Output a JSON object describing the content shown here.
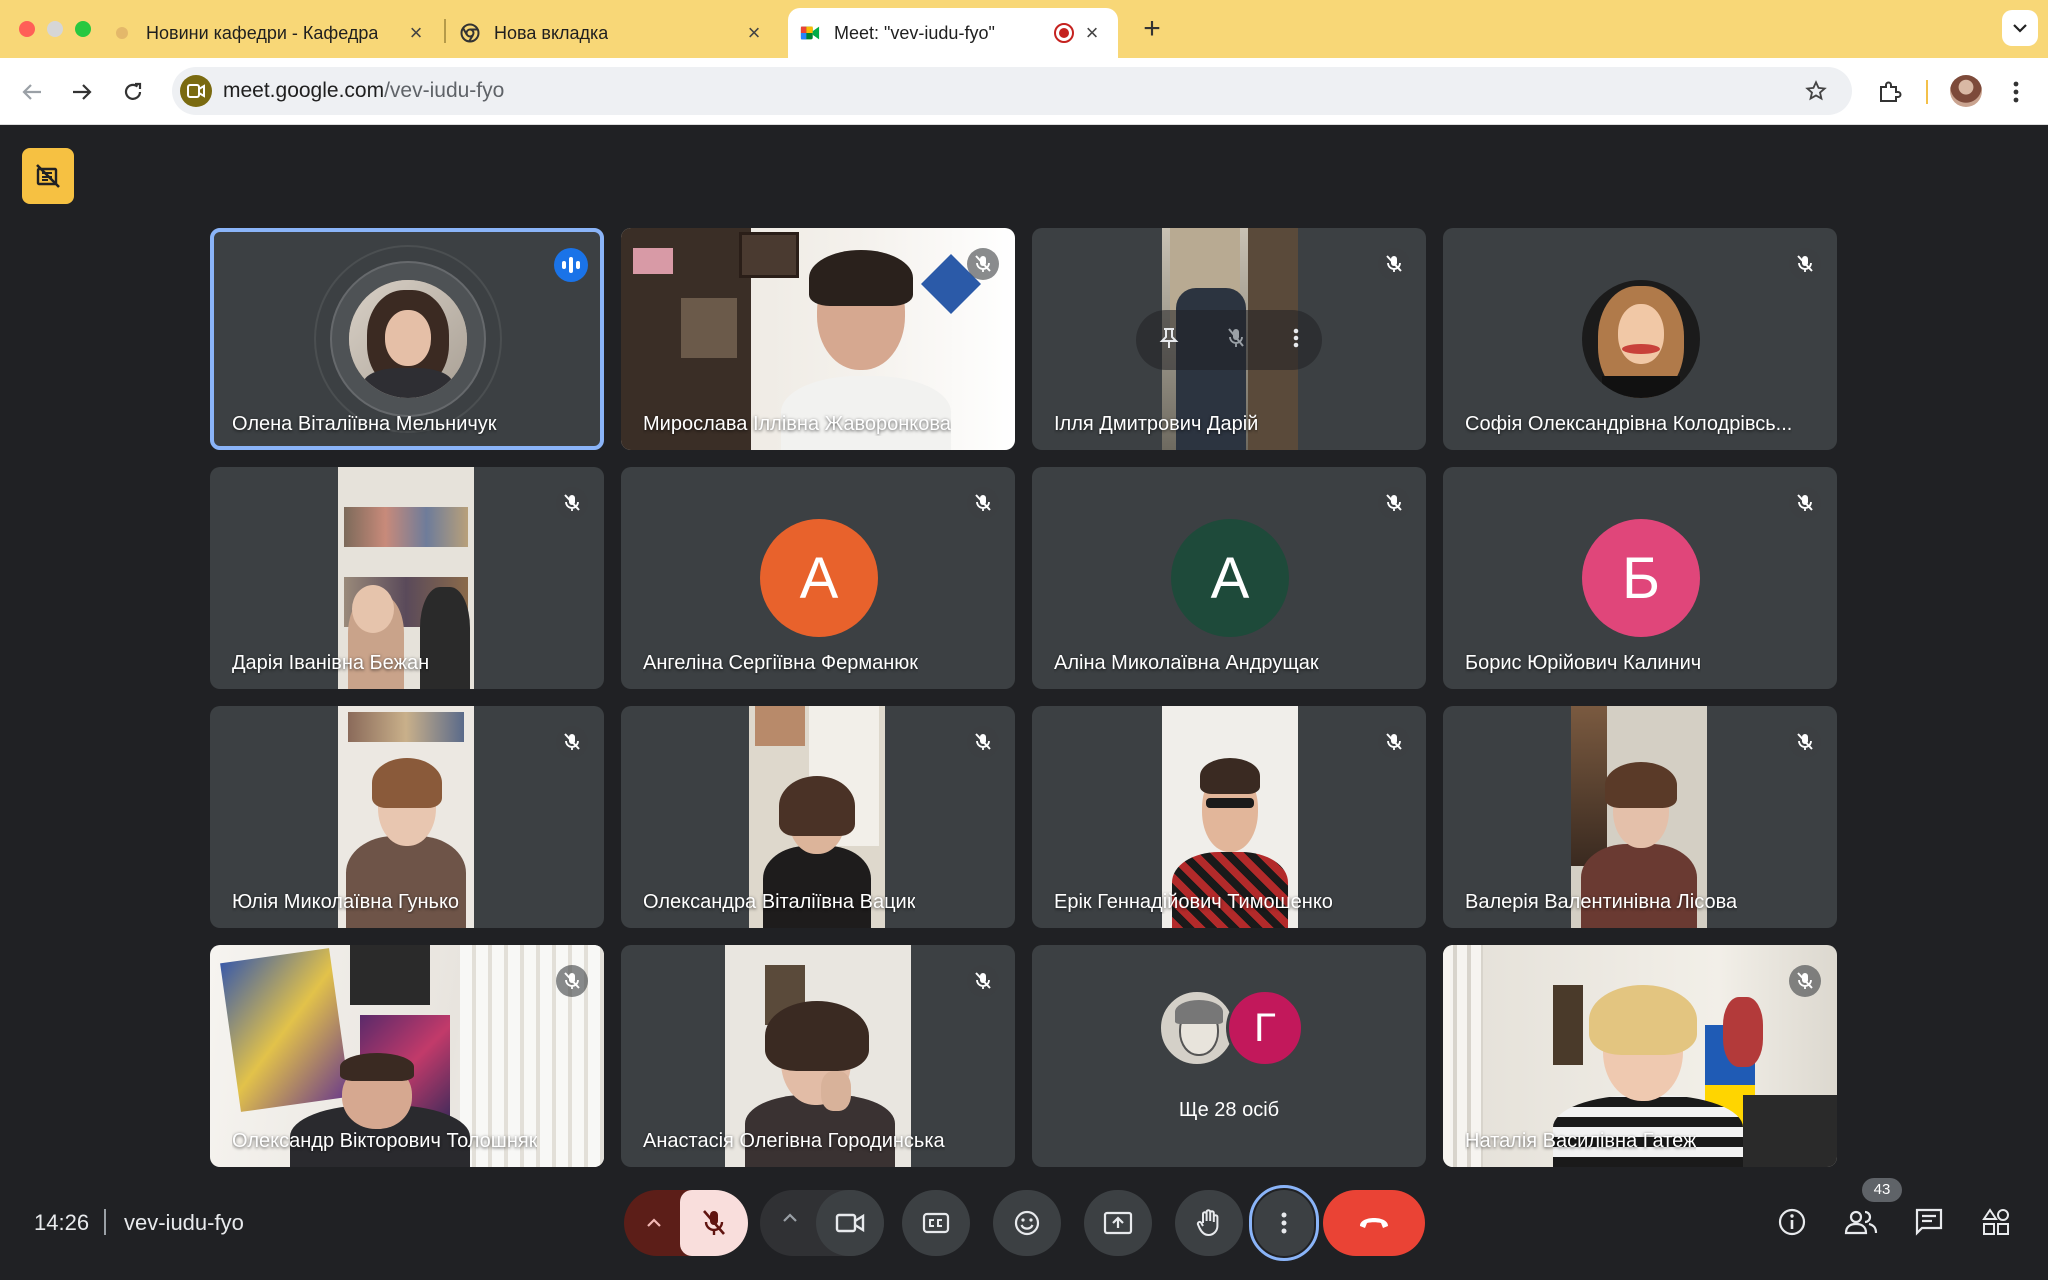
{
  "browser": {
    "tabs": [
      {
        "title": "Новини кафедри - Кафедра",
        "active": false
      },
      {
        "title": "Нова вкладка",
        "active": false
      },
      {
        "title": "Meet: \"vev-iudu-fyo\"",
        "active": true
      }
    ],
    "url_host": "meet.google.com",
    "url_path": "/vev-iudu-fyo",
    "new_tab_label": "+"
  },
  "meet": {
    "participants": [
      {
        "name": "Олена Віталіївна Мельничук",
        "speaking": true
      },
      {
        "name": "Мирослава Іллівна Жаворонкова"
      },
      {
        "name": "Ілля Дмитрович Дарій"
      },
      {
        "name": "Софія Олександрівна Колодрівсь..."
      },
      {
        "name": "Дарія Іванівна Бежан"
      },
      {
        "name": "Ангеліна Сергіївна Ферманюк",
        "initial": "А",
        "color": "#e8622c"
      },
      {
        "name": "Аліна Миколаївна Андрущак",
        "initial": "А",
        "color": "#1e4a3a"
      },
      {
        "name": "Борис Юрійович Калинич",
        "initial": "Б",
        "color": "#e0467a"
      },
      {
        "name": "Юлія Миколаївна Гунько"
      },
      {
        "name": "Олександра Віталіївна Вацик"
      },
      {
        "name": "Ерік Геннадійович Тимошенко"
      },
      {
        "name": "Валерія Валентинівна Лісова"
      },
      {
        "name": "Олександр Вікторович Толошняк"
      },
      {
        "name": "Анастасія Олегівна Городинська"
      },
      {
        "name": "Наталія Василівна Гатеж"
      }
    ],
    "more": {
      "label": "Ще 28 осіб",
      "initial": "Г"
    },
    "time": "14:26",
    "meeting_code": "vev-iudu-fyo",
    "people_count": "43"
  }
}
